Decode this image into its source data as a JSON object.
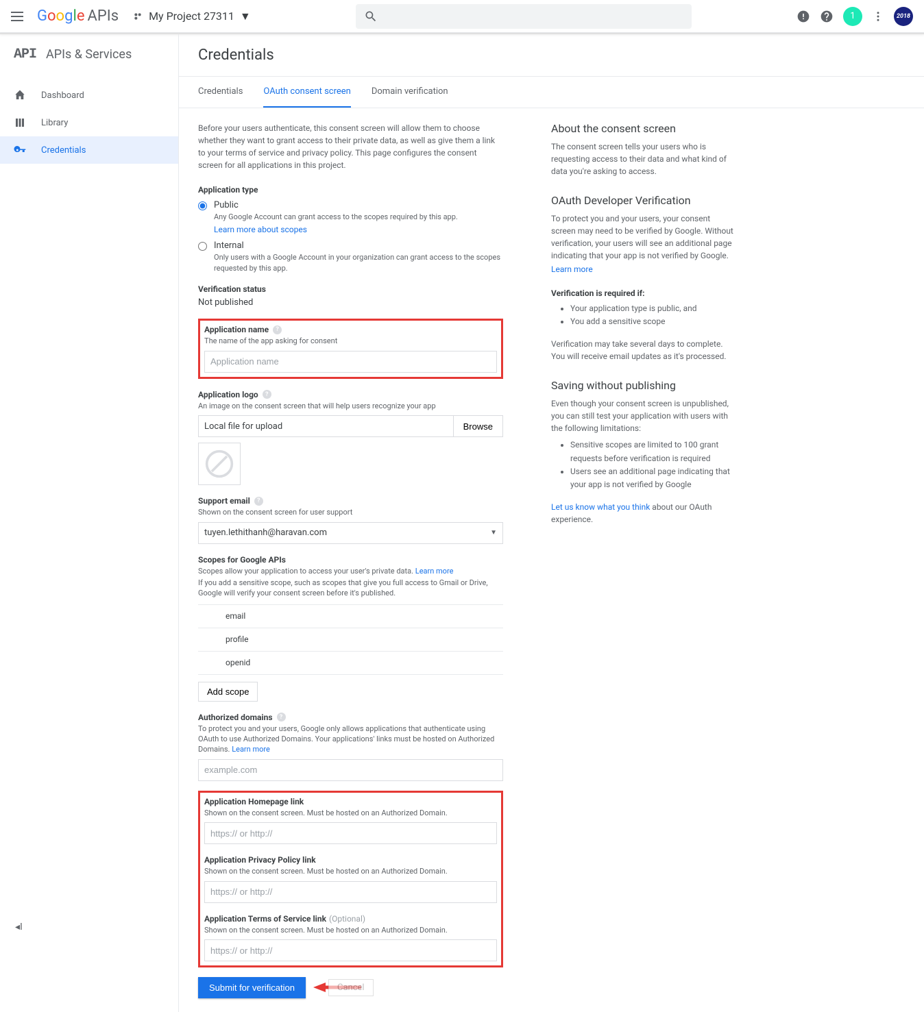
{
  "header": {
    "project_name": "My Project 27311",
    "avatar1_text": "1",
    "avatar2_text": "2018"
  },
  "sidebar": {
    "title": "APIs & Services",
    "items": [
      {
        "label": "Dashboard"
      },
      {
        "label": "Library"
      },
      {
        "label": "Credentials"
      }
    ]
  },
  "page": {
    "title": "Credentials"
  },
  "tabs": [
    {
      "label": "Credentials"
    },
    {
      "label": "OAuth consent screen"
    },
    {
      "label": "Domain verification"
    }
  ],
  "form": {
    "intro": "Before your users authenticate, this consent screen will allow them to choose whether they want to grant access to their private data, as well as give them a link to your terms of service and privacy policy. This page configures the consent screen for all applications in this project.",
    "app_type_label": "Application type",
    "app_type_public": "Public",
    "app_type_public_desc": "Any Google Account can grant access to the scopes required by this app.",
    "app_type_public_link": "Learn more about scopes",
    "app_type_internal": "Internal",
    "app_type_internal_desc": "Only users with a Google Account in your organization can grant access to the scopes requested by this app.",
    "verif_label": "Verification status",
    "verif_value": "Not published",
    "app_name_label": "Application name",
    "app_name_desc": "The name of the app asking for consent",
    "app_name_placeholder": "Application name",
    "app_logo_label": "Application logo",
    "app_logo_desc": "An image on the consent screen that will help users recognize your app",
    "app_logo_file": "Local file for upload",
    "browse_btn": "Browse",
    "support_label": "Support email",
    "support_desc": "Shown on the consent screen for user support",
    "support_value": "tuyen.lethithanh@haravan.com",
    "scopes_label": "Scopes for Google APIs",
    "scopes_desc1": "Scopes allow your application to access your user's private data.",
    "scopes_learn": "Learn more",
    "scopes_desc2": "If you add a sensitive scope, such as scopes that give you full access to Gmail or Drive, Google will verify your consent screen before it's published.",
    "scope_items": [
      "email",
      "profile",
      "openid"
    ],
    "add_scope": "Add scope",
    "auth_domains_label": "Authorized domains",
    "auth_domains_desc": "To protect you and your users, Google only allows applications that authenticate using OAuth to use Authorized Domains. Your applications' links must be hosted on Authorized Domains.",
    "auth_domains_learn": "Learn more",
    "auth_domains_placeholder": "example.com",
    "home_label": "Application Homepage link",
    "hosted_desc": "Shown on the consent screen. Must be hosted on an Authorized Domain.",
    "url_placeholder": "https:// or http://",
    "privacy_label": "Application Privacy Policy link",
    "tos_label": "Application Terms of Service link",
    "tos_optional": "(Optional)",
    "submit_btn": "Submit for verification",
    "cancel_btn": "Cancel"
  },
  "right": {
    "h1": "About the consent screen",
    "t1": "The consent screen tells your users who is requesting access to their data and what kind of data you're asking to access.",
    "h2": "OAuth Developer Verification",
    "t2": "To protect you and your users, your consent screen may need to be verified by Google. Without verification, your users will see an additional page indicating that your app is not verified by Google.",
    "learn": "Learn more",
    "req_label": "Verification is required if:",
    "req1": "Your application type is public, and",
    "req2": "You add a sensitive scope",
    "t3": "Verification may take several days to complete. You will receive email updates as it's processed.",
    "h3": "Saving without publishing",
    "t4": "Even though your consent screen is unpublished, you can still test your application with users with the following limitations:",
    "lim1": "Sensitive scopes are limited to 100 grant requests before verification is required",
    "lim2": "Users see an additional page indicating that your app is not verified by Google",
    "fb_link": "Let us know what you think",
    "fb_text": " about our OAuth experience."
  }
}
